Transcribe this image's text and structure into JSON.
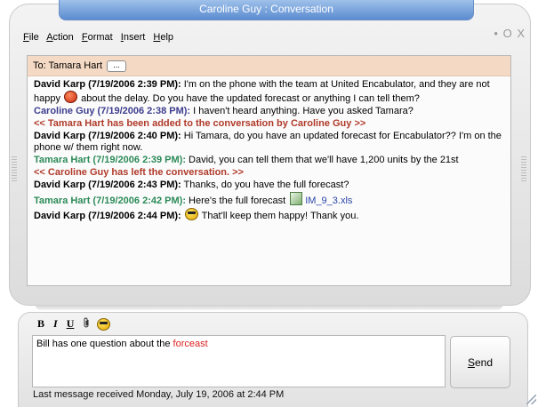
{
  "window": {
    "title": "Caroline Guy : Conversation",
    "controls": {
      "minimize_glyph": "•",
      "restore_glyph": "O",
      "close_glyph": "X"
    }
  },
  "menu": [
    {
      "label": "File"
    },
    {
      "label": "Action"
    },
    {
      "label": "Format"
    },
    {
      "label": "Insert"
    },
    {
      "label": "Help"
    }
  ],
  "to_bar": {
    "label": "To: Tamara Hart",
    "more_button": "..."
  },
  "messages": [
    {
      "sender": "David Karp (7/19/2006 2:39 PM):",
      "text_before": " I'm on the phone with the team at United Encabulator, and they are not happy",
      "icon": "angry-face-icon",
      "text_after": " about the delay.  Do you have the updated forecast or anything I can tell them?"
    },
    {
      "sender": "Caroline Guy (7/19/2006 2:38 PM):",
      "text": " I haven't heard anything. Have you asked Tamara?"
    },
    {
      "system": "<< Tamara Hart  has been added to the conversation by Caroline Guy >>"
    },
    {
      "sender": "David Karp (7/19/2006 2:40 PM):",
      "text": " Hi Tamara, do you have an updated forecast for Encabulator?? I'm on the phone w/ them right now."
    },
    {
      "sender": "Tamara Hart (7/19/2006 2:39 PM):",
      "text": " David, you can tell them that we'll have 1,200 units by the 21st"
    },
    {
      "system": "<< Caroline Guy has left the conversation. >>"
    },
    {
      "sender": "David Karp (7/19/2006 2:43 PM):",
      "text": " Thanks, do you have the full forecast?"
    },
    {
      "sender": "Tamara Hart (7/19/2006 2:42 PM):",
      "text": " Here's the full forecast",
      "file_icon": "excel-file-icon",
      "file": "IM_9_3.xls"
    },
    {
      "sender": "David Karp (7/19/2006 2:44 PM):",
      "icon": "cool-face-icon",
      "text_after": " That'll keep them happy!  Thank you."
    }
  ],
  "format_toolbar": {
    "bold": "B",
    "italic": "I",
    "underline": "U"
  },
  "compose": {
    "text": "Bill has one question about the ",
    "misspelled_word": "forceast"
  },
  "send_button": {
    "label": "Send"
  },
  "status": {
    "text": "Last message received Monday, July 19, 2006 at 2:44 PM"
  },
  "colors": {
    "title_bar": "#5b8bd0",
    "to_bar": "#f4d9c4",
    "david": "#000000",
    "caroline": "#3d3d8f",
    "tamara": "#2b8a58",
    "system_notice": "#b03a2a",
    "misspelling": "#dd2222"
  }
}
